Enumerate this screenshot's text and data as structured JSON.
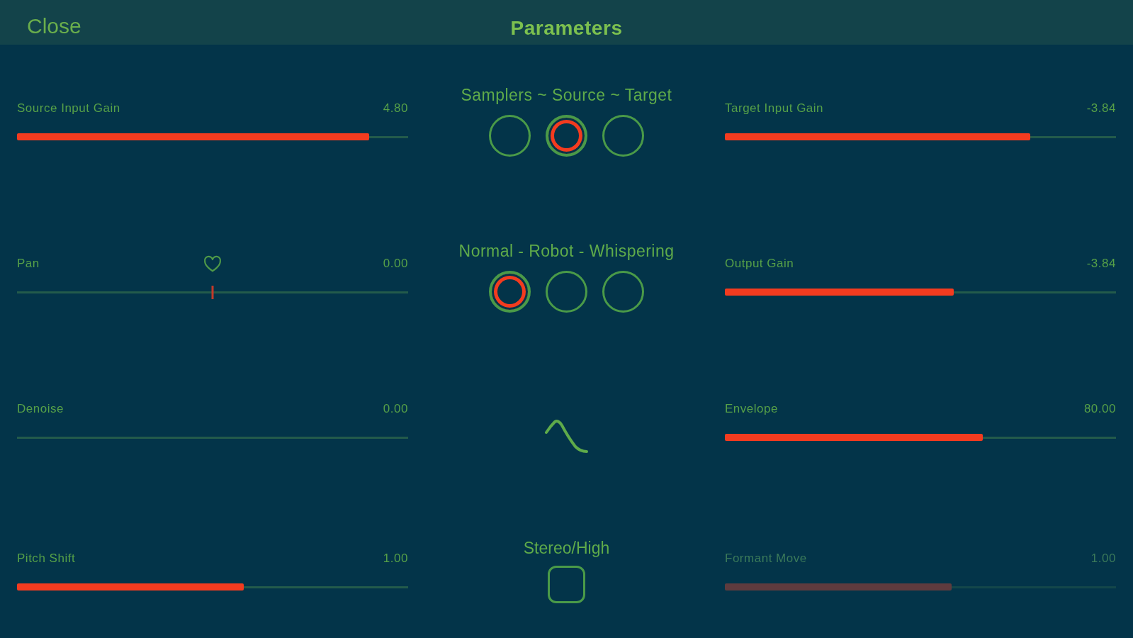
{
  "header": {
    "close_button": "Close",
    "title": "Parameters"
  },
  "left_sliders": [
    {
      "kind": "bar",
      "label": "Source Input Gain",
      "value": "4.80",
      "level": 0.9,
      "disabled": false
    },
    {
      "kind": "center",
      "label": "Pan",
      "value": "0.00",
      "level": 0.5,
      "disabled": false
    },
    {
      "kind": "bar",
      "label": "Denoise",
      "value": "0.00",
      "level": 0,
      "disabled": false
    },
    {
      "kind": "bar",
      "label": "Pitch Shift",
      "value": "1.00",
      "level": 0.58,
      "disabled": false
    }
  ],
  "center": {
    "selectors": [
      {
        "title": "Samplers ~ Source ~ Target",
        "options": [
          {
            "selected": false
          },
          {
            "selected": true
          },
          {
            "selected": false
          }
        ]
      },
      {
        "title": "Normal - Robot - Whispering",
        "options": [
          {
            "selected": true
          },
          {
            "selected": false
          },
          {
            "selected": false
          }
        ]
      }
    ],
    "checkbox": {
      "label": "Stereo/High",
      "checked": false
    }
  },
  "right_sliders": [
    {
      "kind": "bar",
      "label": "Target Input Gain",
      "value": "-3.84",
      "level": 0.78,
      "disabled": false
    },
    {
      "kind": "bar",
      "label": "Output Gain",
      "value": "-3.84",
      "level": 0.585,
      "disabled": false
    },
    {
      "kind": "bar",
      "label": "Envelope",
      "value": "80.00",
      "level": 0.66,
      "disabled": false
    },
    {
      "kind": "bar",
      "label": "Formant Move",
      "value": "1.00",
      "level": 0.58,
      "disabled": true
    }
  ]
}
